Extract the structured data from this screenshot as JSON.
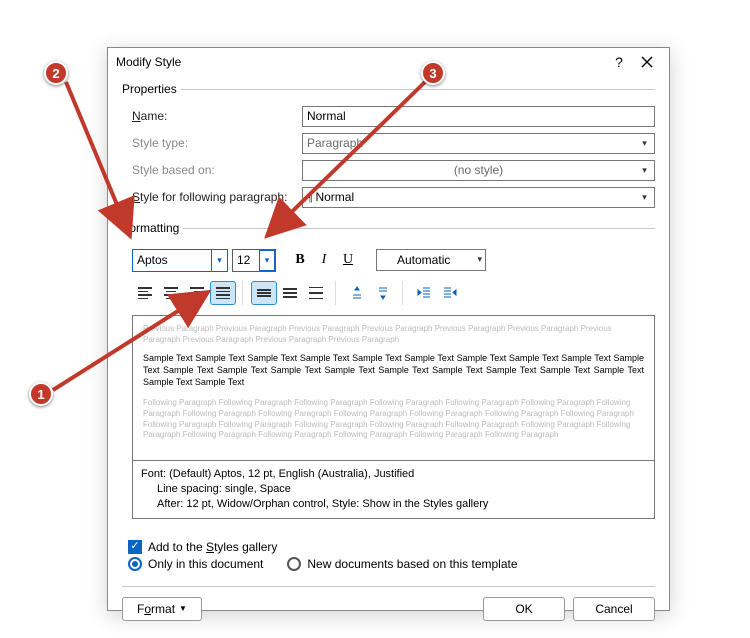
{
  "dialog": {
    "title": "Modify Style"
  },
  "groups": {
    "properties": "Properties",
    "formatting": "Formatting"
  },
  "props": {
    "name_label": "Name:",
    "name_value": "Normal",
    "type_label": "Style type:",
    "type_value": "Paragraph",
    "based_label": "Style based on:",
    "based_value": "(no style)",
    "follow_label": "Style for following paragraph:",
    "follow_value": "Normal"
  },
  "fmt": {
    "font": "Aptos",
    "size": "12",
    "bold": "B",
    "italic": "I",
    "underline": "U",
    "color_label": "Automatic"
  },
  "preview": {
    "ghost_prev": "Previous Paragraph Previous Paragraph Previous Paragraph Previous Paragraph Previous Paragraph Previous Paragraph Previous Paragraph Previous Paragraph Previous Paragraph Previous Paragraph",
    "sample": "Sample Text Sample Text Sample Text Sample Text Sample Text Sample Text Sample Text Sample Text Sample Text Sample Text Sample Text Sample Text Sample Text Sample Text Sample Text Sample Text Sample Text Sample Text Sample Text Sample Text Sample Text",
    "ghost_next": "Following Paragraph Following Paragraph Following Paragraph Following Paragraph Following Paragraph Following Paragraph Following Paragraph Following Paragraph Following Paragraph Following Paragraph Following Paragraph Following Paragraph Following Paragraph Following Paragraph Following Paragraph Following Paragraph Following Paragraph Following Paragraph Following Paragraph Following Paragraph Following Paragraph Following Paragraph Following Paragraph Following Paragraph Following Paragraph"
  },
  "desc": {
    "line1": "Font: (Default) Aptos, 12 pt, English (Australia), Justified",
    "line2": "Line spacing:  single, Space",
    "line3": "After:  12 pt, Widow/Orphan control, Style: Show in the Styles gallery"
  },
  "checks": {
    "add_gallery": "Add to the Styles gallery",
    "only_doc": "Only in this document",
    "new_docs": "New documents based on this template"
  },
  "buttons": {
    "format": "Format",
    "ok": "OK",
    "cancel": "Cancel"
  },
  "callouts": {
    "c1": "1",
    "c2": "2",
    "c3": "3"
  }
}
